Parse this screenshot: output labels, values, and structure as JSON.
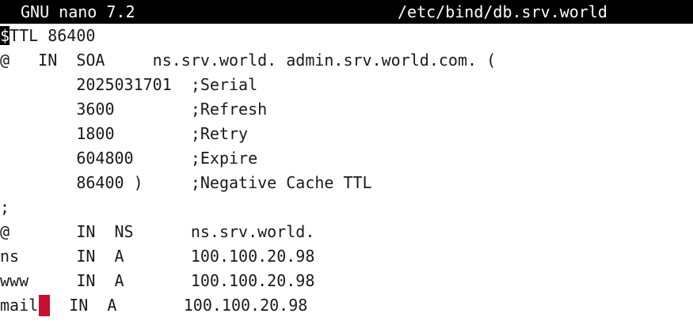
{
  "titlebar": {
    "app": "GNU nano 7.2",
    "filename": "/etc/bind/db.srv.world"
  },
  "cursor_char": "$",
  "lines": [
    "TTL 86400",
    "@   IN  SOA     ns.srv.world. admin.srv.world.com. (",
    "        2025031701  ;Serial",
    "        3600        ;Refresh",
    "        1800        ;Retry",
    "        604800      ;Expire",
    "        86400 )     ;Negative Cache TTL",
    ";",
    "@       IN  NS      ns.srv.world.",
    "ns      IN  A       100.100.20.98",
    "www     IN  A       100.100.20.98",
    "mail",
    "IN  A       100.100.20.98"
  ],
  "colors": {
    "titlebar_bg": "#000000",
    "marker": "#c8102e"
  }
}
